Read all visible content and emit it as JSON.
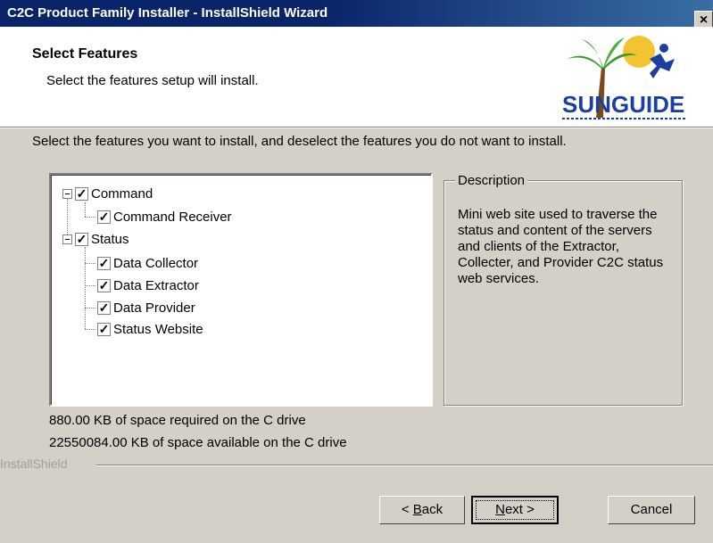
{
  "window": {
    "title": "C2C Product Family Installer - InstallShield Wizard",
    "close_glyph": "×"
  },
  "header": {
    "title": "Select Features",
    "subtitle": "Select the features setup will install."
  },
  "instruction": "Select the features you want to install, and deselect the features you do not want to install.",
  "tree": {
    "items": [
      {
        "label": "Command",
        "checked": true,
        "level": 0,
        "expanded": true
      },
      {
        "label": "Command Receiver",
        "checked": true,
        "level": 1
      },
      {
        "label": "Status",
        "checked": true,
        "level": 0,
        "expanded": true
      },
      {
        "label": "Data Collector",
        "checked": true,
        "level": 1
      },
      {
        "label": "Data Extractor",
        "checked": true,
        "level": 1
      },
      {
        "label": "Data Provider",
        "checked": true,
        "level": 1
      },
      {
        "label": "Status Website",
        "checked": true,
        "level": 1
      }
    ],
    "check_glyph": "✓"
  },
  "description": {
    "label": "Description",
    "text": "Mini web site used to traverse the status and content of the servers and clients of the Extractor, Collecter, and Provider C2C status web services."
  },
  "space": {
    "required": "880.00 KB of space required on the C drive",
    "available": "22550084.00 KB of space available on the C drive"
  },
  "brand": "InstallShield",
  "buttons": {
    "back_prefix": "< ",
    "back_key": "B",
    "back_rest": "ack",
    "next_key": "N",
    "next_rest": "ext >",
    "cancel": "Cancel"
  },
  "colors": {
    "titlebar": "#0a246a",
    "dialog_bg": "#d4d0c8",
    "logo_text": "#1a3fa0"
  },
  "logo": {
    "text": "SUNGUIDE"
  }
}
